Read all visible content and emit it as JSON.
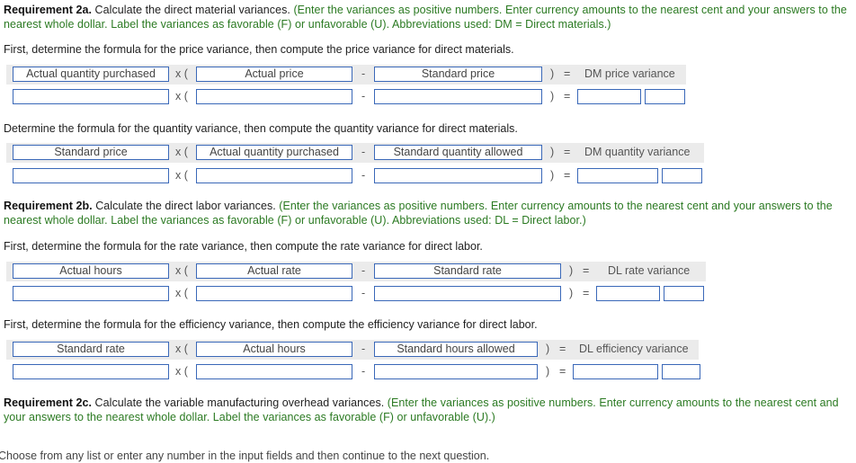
{
  "req2a": {
    "title": "Requirement 2a.",
    "text": " Calculate the direct material variances. ",
    "note": "(Enter the variances as positive numbers. Enter currency amounts to the nearest cent and your answers to the nearest whole dollar. Label the variances as favorable (F) or unfavorable (U). Abbreviations used: DM = Direct materials.)",
    "price": {
      "instruction": "First, determine the formula for the price variance, then compute the price variance for direct materials.",
      "headers": [
        "Actual quantity purchased",
        "Actual price",
        "Standard price"
      ],
      "result_label": "DM price variance",
      "values": [
        "",
        "",
        "",
        "",
        ""
      ]
    },
    "quantity": {
      "instruction": "Determine the formula for the quantity variance, then compute the quantity variance for direct materials.",
      "headers": [
        "Standard price",
        "Actual quantity purchased",
        "Standard quantity allowed"
      ],
      "result_label": "DM quantity variance",
      "values": [
        "",
        "",
        "",
        "",
        ""
      ]
    }
  },
  "req2b": {
    "title": "Requirement 2b.",
    "text": " Calculate the direct labor variances. ",
    "note": "(Enter the variances as positive numbers. Enter currency amounts to the nearest cent and your answers to the nearest whole dollar. Label the variances as favorable (F) or unfavorable (U). Abbreviations used: DL = Direct labor.)",
    "rate": {
      "instruction": "First, determine the formula for the rate variance, then compute the rate variance for direct labor.",
      "headers": [
        "Actual hours",
        "Actual rate",
        "Standard rate"
      ],
      "result_label": "DL rate variance",
      "values": [
        "",
        "",
        "",
        "",
        ""
      ]
    },
    "efficiency": {
      "instruction": "First, determine the formula for the efficiency variance, then compute the efficiency variance for direct labor.",
      "headers": [
        "Standard rate",
        "Actual hours",
        "Standard hours allowed"
      ],
      "result_label": "DL efficiency variance",
      "values": [
        "",
        "",
        "",
        "",
        ""
      ]
    }
  },
  "req2c": {
    "title": "Requirement 2c.",
    "text": " Calculate the variable manufacturing overhead variances. ",
    "note": "(Enter the variances as positive numbers. Enter currency amounts to the nearest cent and your answers to the nearest whole dollar. Label the variances as favorable (F) or unfavorable (U).)"
  },
  "symbols": {
    "times_open": "x (",
    "minus": "-",
    "close": ")",
    "equals": "="
  },
  "footer": "Choose from any list or enter any number in the input fields and then continue to the next question."
}
